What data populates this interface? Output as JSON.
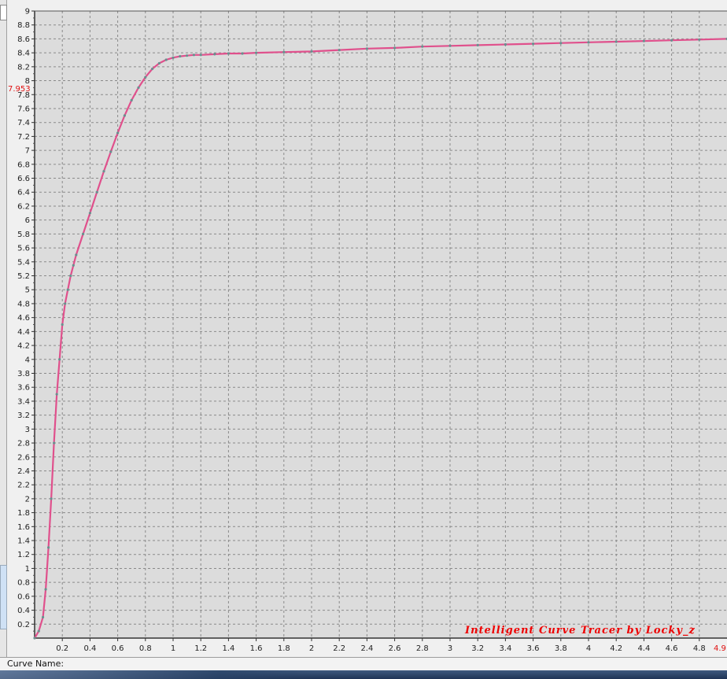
{
  "window": {
    "curve_name_label": "Curve Name:",
    "watermark": "Intelligent Curve Tracer by Locky_z",
    "marker_value": "7.953",
    "x_end_marker": "4.9"
  },
  "colors": {
    "plot_background": "#dcdcdc",
    "grid": "#8a8a8a",
    "curve_line": "#e0508c",
    "curve_markers": "#6a8f8f",
    "watermark": "#ee0000",
    "marker_label": "#e01010"
  },
  "chart_data": {
    "type": "line",
    "title": "",
    "xlabel": "",
    "ylabel": "",
    "xlim": [
      0,
      5
    ],
    "ylim": [
      0,
      9
    ],
    "grid": true,
    "x_ticks": [
      "0.2",
      "0.4",
      "0.6",
      "0.8",
      "1",
      "1.2",
      "1.4",
      "1.6",
      "1.8",
      "2",
      "2.2",
      "2.4",
      "2.6",
      "2.8",
      "3",
      "3.2",
      "3.4",
      "3.6",
      "3.8",
      "4",
      "4.2",
      "4.4",
      "4.6",
      "4.8"
    ],
    "y_ticks": [
      "0.2",
      "0.4",
      "0.6",
      "0.8",
      "1",
      "1.2",
      "1.4",
      "1.6",
      "1.8",
      "2",
      "2.2",
      "2.4",
      "2.6",
      "2.8",
      "3",
      "3.2",
      "3.4",
      "3.6",
      "3.8",
      "4",
      "4.2",
      "4.4",
      "4.6",
      "4.8",
      "5",
      "5.2",
      "5.4",
      "5.6",
      "5.8",
      "6",
      "6.2",
      "6.4",
      "6.6",
      "6.8",
      "7",
      "7.2",
      "7.4",
      "7.6",
      "7.8",
      "8",
      "8.2",
      "8.4",
      "8.6",
      "8.8",
      "9"
    ],
    "series": [
      {
        "x": [
          0.0,
          0.03,
          0.06,
          0.08,
          0.1,
          0.12,
          0.14,
          0.16,
          0.18,
          0.2,
          0.22,
          0.24,
          0.26,
          0.28,
          0.3,
          0.35,
          0.4,
          0.45,
          0.5,
          0.55,
          0.6,
          0.65,
          0.7,
          0.75,
          0.8,
          0.85,
          0.9,
          0.95,
          1.0,
          1.05,
          1.1,
          1.15,
          1.2,
          1.3,
          1.4,
          1.5,
          1.6,
          1.8,
          2.0,
          2.2,
          2.4,
          2.6,
          2.8,
          3.0,
          3.2,
          3.4,
          3.6,
          3.8,
          4.0,
          4.2,
          4.4,
          4.6,
          4.8,
          5.0
        ],
        "y": [
          0.0,
          0.1,
          0.3,
          0.7,
          1.3,
          2.0,
          2.8,
          3.5,
          4.0,
          4.5,
          4.8,
          5.0,
          5.2,
          5.35,
          5.5,
          5.8,
          6.1,
          6.4,
          6.7,
          6.98,
          7.25,
          7.5,
          7.72,
          7.9,
          8.05,
          8.17,
          8.25,
          8.3,
          8.33,
          8.35,
          8.36,
          8.37,
          8.37,
          8.38,
          8.39,
          8.39,
          8.4,
          8.41,
          8.42,
          8.44,
          8.46,
          8.47,
          8.49,
          8.5,
          8.51,
          8.52,
          8.53,
          8.54,
          8.55,
          8.56,
          8.57,
          8.58,
          8.59,
          8.6
        ]
      }
    ]
  }
}
